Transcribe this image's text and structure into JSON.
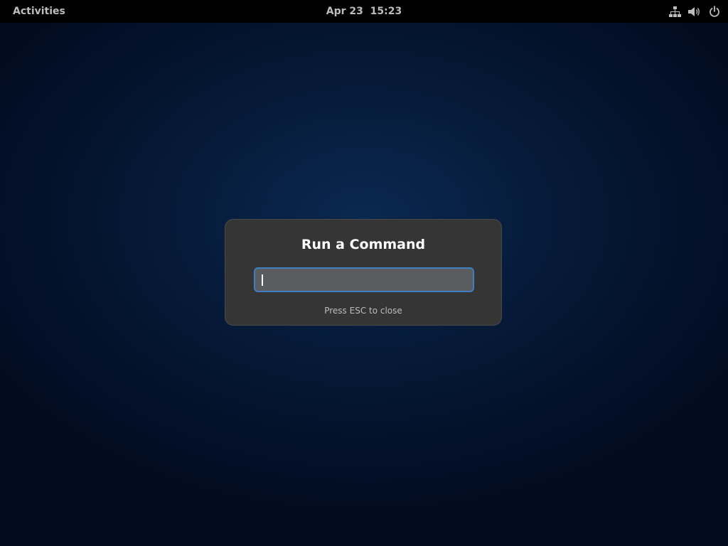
{
  "topbar": {
    "activities_label": "Activities",
    "clock": "Apr 23  15:23",
    "tray_icons": [
      "network-icon",
      "volume-icon",
      "power-icon"
    ]
  },
  "run_dialog": {
    "title": "Run a Command",
    "input_value": "",
    "hint": "Press ESC to close"
  },
  "colors": {
    "topbar_bg": "#000000",
    "dialog_bg": "#353535",
    "input_focus_border": "#3f7ec4",
    "desktop_bg": "#061a38"
  }
}
